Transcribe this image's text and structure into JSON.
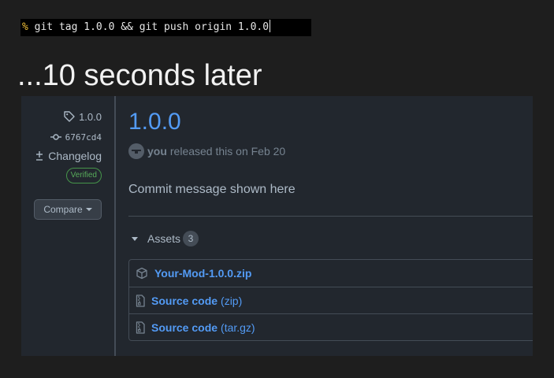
{
  "terminal": {
    "prompt": "%",
    "command": "git tag 1.0.0 && git push origin 1.0.0"
  },
  "heading": "...10 seconds later",
  "release": {
    "tag": "1.0.0",
    "commit": "6767cd4",
    "changelog_label": "Changelog",
    "verified_label": "Verified",
    "compare_label": "Compare",
    "title": "1.0.0",
    "byline_user": "you",
    "byline_text": "released this on Feb 20",
    "commit_message": "Commit message shown here",
    "assets_label": "Assets",
    "assets_count": "3",
    "assets": [
      {
        "name": "Your-Mod-1.0.0.zip",
        "suffix": ""
      },
      {
        "name": "Source code",
        "suffix": "(zip)"
      },
      {
        "name": "Source code",
        "suffix": "(tar.gz)"
      }
    ]
  },
  "colors": {
    "link": "#539bf5",
    "panel_bg": "#22272e",
    "page_bg": "#1e1e1e",
    "prompt": "#f2c037",
    "verified": "#57ab5a"
  },
  "icons": [
    "tag-icon",
    "commit-icon",
    "diff-icon",
    "package-icon",
    "file-zip-icon",
    "caret-down-icon"
  ]
}
